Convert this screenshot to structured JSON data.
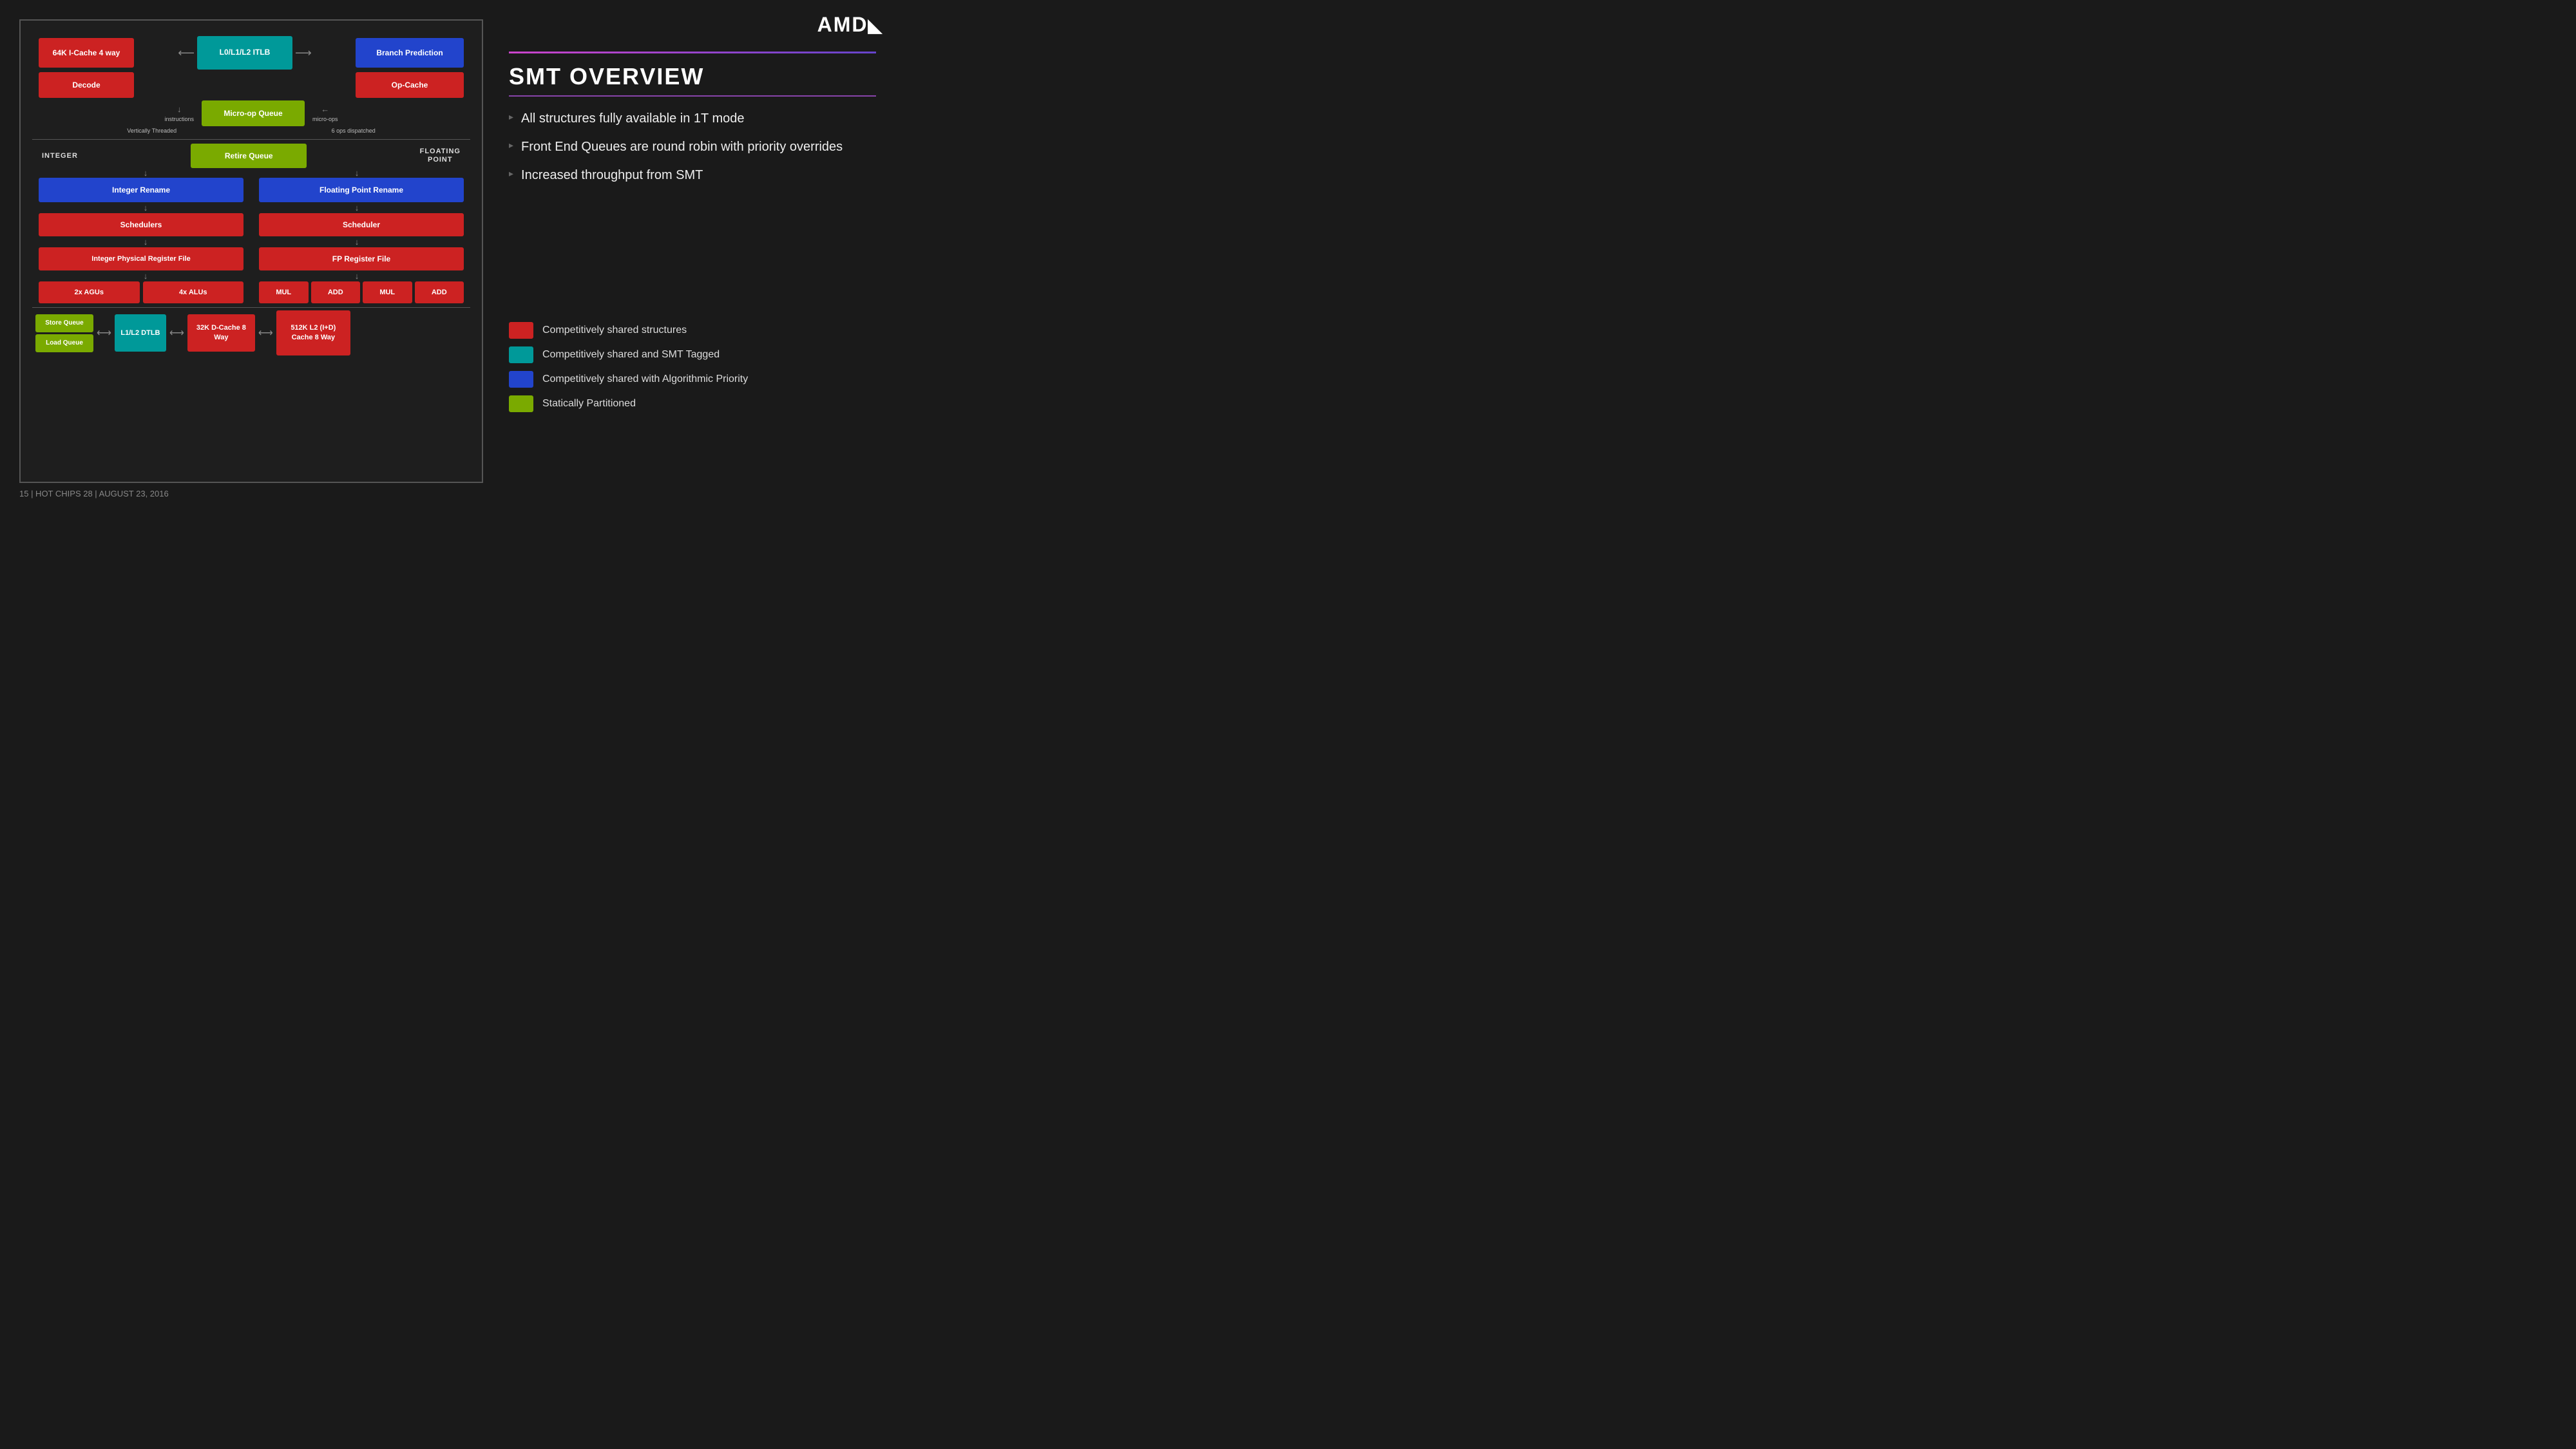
{
  "logo": {
    "text": "AMD",
    "arrow": "▶"
  },
  "diagram": {
    "boxes": {
      "icache": "64K I-Cache 4 way",
      "l0l1l2": "L0/L1/L2\nITLB",
      "branch_pred": "Branch Prediction",
      "decode": "Decode",
      "op_cache": "Op-Cache",
      "micro_op_queue": "Micro-op Queue",
      "retire_queue": "Retire Queue",
      "integer_rename": "Integer Rename",
      "fp_rename": "Floating Point Rename",
      "schedulers": "Schedulers",
      "fp_scheduler": "Scheduler",
      "int_reg_file": "Integer Physical Register File",
      "fp_reg_file": "FP Register File",
      "agu_2x": "2x AGUs",
      "alu_4x": "4x ALUs",
      "mul1": "MUL",
      "add1": "ADD",
      "mul2": "MUL",
      "add2": "ADD",
      "store_queue": "Store Queue",
      "load_queue": "Load Queue",
      "l1l2_dtlb": "L1/L2\nDTLB",
      "dcache": "32K D-Cache\n8 Way",
      "l2_cache": "512K\nL2 (I+D) Cache\n8 Way"
    },
    "labels": {
      "instructions": "instructions",
      "vertically_threaded": "Vertically Threaded",
      "ops_dispatched": "6 ops dispatched",
      "micro_ops": "micro-ops",
      "integer": "INTEGER",
      "floating_point": "FLOATING\nPOINT"
    }
  },
  "panel": {
    "title": "SMT OVERVIEW",
    "bullets": [
      "All structures fully available in 1T mode",
      "Front End Queues are round robin with priority overrides",
      "Increased throughput from SMT"
    ]
  },
  "legend": {
    "items": [
      {
        "color": "#cc2222",
        "label": "Competitively shared structures"
      },
      {
        "color": "#009999",
        "label": "Competitively shared and SMT Tagged"
      },
      {
        "color": "#2244cc",
        "label": "Competitively shared with Algorithmic Priority"
      },
      {
        "color": "#7aaa00",
        "label": "Statically Partitioned"
      }
    ]
  },
  "footer": {
    "text": "15  |  HOT CHIPS 28  |  AUGUST 23, 2016"
  }
}
